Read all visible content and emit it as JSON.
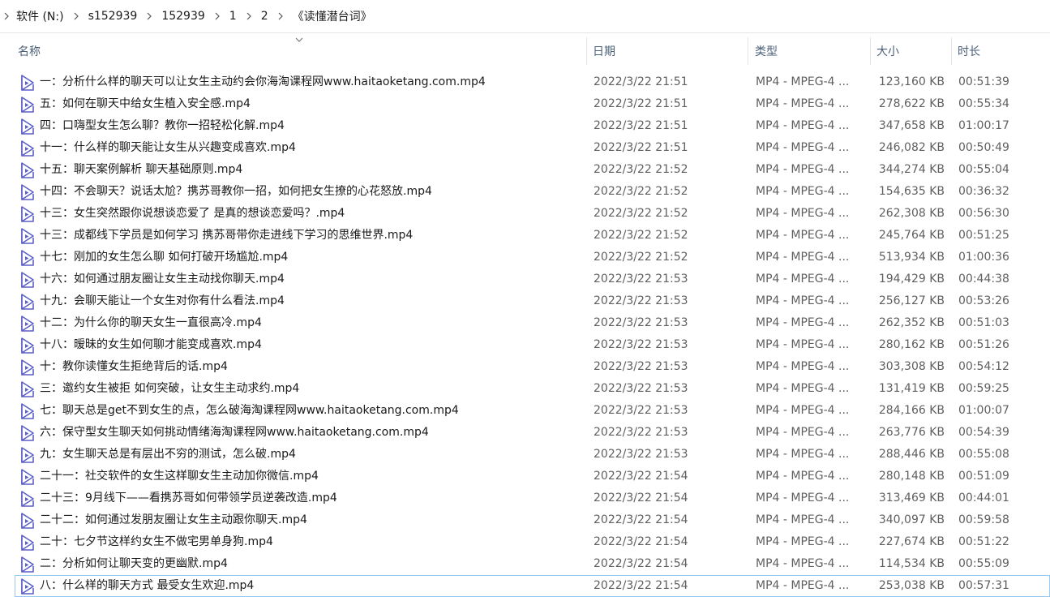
{
  "breadcrumb": [
    "软件 (N:)",
    "s152939",
    "152939",
    "1",
    "2",
    "《读懂潜台词》"
  ],
  "columns": {
    "name": "名称",
    "date": "日期",
    "type": "类型",
    "size": "大小",
    "duration": "时长"
  },
  "files": [
    {
      "name": "一：分析什么样的聊天可以让女生主动约会你海淘课程网www.haitaoketang.com.mp4",
      "date": "2022/3/22 21:51",
      "type": "MP4 - MPEG-4 ...",
      "size": "123,160 KB",
      "duration": "00:51:39"
    },
    {
      "name": "五：如何在聊天中给女生植入安全感.mp4",
      "date": "2022/3/22 21:51",
      "type": "MP4 - MPEG-4 ...",
      "size": "278,622 KB",
      "duration": "00:55:34"
    },
    {
      "name": "四：口嗨型女生怎么聊？教你一招轻松化解.mp4",
      "date": "2022/3/22 21:51",
      "type": "MP4 - MPEG-4 ...",
      "size": "347,658 KB",
      "duration": "01:00:17"
    },
    {
      "name": "十一：什么样的聊天能让女生从兴趣变成喜欢.mp4",
      "date": "2022/3/22 21:51",
      "type": "MP4 - MPEG-4 ...",
      "size": "246,082 KB",
      "duration": "00:50:49"
    },
    {
      "name": "十五：聊天案例解析 聊天基础原则.mp4",
      "date": "2022/3/22 21:52",
      "type": "MP4 - MPEG-4 ...",
      "size": "344,274 KB",
      "duration": "00:55:04"
    },
    {
      "name": "十四：不会聊天？说话太尬？携苏哥教你一招，如何把女生撩的心花怒放.mp4",
      "date": "2022/3/22 21:52",
      "type": "MP4 - MPEG-4 ...",
      "size": "154,635 KB",
      "duration": "00:36:32"
    },
    {
      "name": "十三：女生突然跟你说想谈恋爱了 是真的想谈恋爱吗？.mp4",
      "date": "2022/3/22 21:52",
      "type": "MP4 - MPEG-4 ...",
      "size": "262,308 KB",
      "duration": "00:56:30"
    },
    {
      "name": "十三：成都线下学员是如何学习 携苏哥带你走进线下学习的思维世界.mp4",
      "date": "2022/3/22 21:52",
      "type": "MP4 - MPEG-4 ...",
      "size": "245,764 KB",
      "duration": "00:51:25"
    },
    {
      "name": "十七：刚加的女生怎么聊 如何打破开场尴尬.mp4",
      "date": "2022/3/22 21:52",
      "type": "MP4 - MPEG-4 ...",
      "size": "513,934 KB",
      "duration": "01:00:36"
    },
    {
      "name": "十六：如何通过朋友圈让女生主动找你聊天.mp4",
      "date": "2022/3/22 21:53",
      "type": "MP4 - MPEG-4 ...",
      "size": "194,429 KB",
      "duration": "00:44:38"
    },
    {
      "name": "十九：会聊天能让一个女生对你有什么看法.mp4",
      "date": "2022/3/22 21:53",
      "type": "MP4 - MPEG-4 ...",
      "size": "256,127 KB",
      "duration": "00:53:26"
    },
    {
      "name": "十二：为什么你的聊天女生一直很高冷.mp4",
      "date": "2022/3/22 21:53",
      "type": "MP4 - MPEG-4 ...",
      "size": "262,352 KB",
      "duration": "00:51:03"
    },
    {
      "name": "十八：暧昧的女生如何聊才能变成喜欢.mp4",
      "date": "2022/3/22 21:53",
      "type": "MP4 - MPEG-4 ...",
      "size": "280,162 KB",
      "duration": "00:51:26"
    },
    {
      "name": "十：教你读懂女生拒绝背后的话.mp4",
      "date": "2022/3/22 21:53",
      "type": "MP4 - MPEG-4 ...",
      "size": "303,308 KB",
      "duration": "00:54:12"
    },
    {
      "name": "三：邀约女生被拒 如何突破，让女生主动求约.mp4",
      "date": "2022/3/22 21:53",
      "type": "MP4 - MPEG-4 ...",
      "size": "131,419 KB",
      "duration": "00:59:25"
    },
    {
      "name": "七：聊天总是get不到女生的点，怎么破海淘课程网www.haitaoketang.com.mp4",
      "date": "2022/3/22 21:53",
      "type": "MP4 - MPEG-4 ...",
      "size": "284,166 KB",
      "duration": "01:00:07"
    },
    {
      "name": "六：保守型女生聊天如何挑动情绪海淘课程网www.haitaoketang.com.mp4",
      "date": "2022/3/22 21:53",
      "type": "MP4 - MPEG-4 ...",
      "size": "263,776 KB",
      "duration": "00:54:39"
    },
    {
      "name": "九：女生聊天总是有层出不穷的测试，怎么破.mp4",
      "date": "2022/3/22 21:53",
      "type": "MP4 - MPEG-4 ...",
      "size": "288,446 KB",
      "duration": "00:55:08"
    },
    {
      "name": "二十一：社交软件的女生这样聊女生主动加你微信.mp4",
      "date": "2022/3/22 21:54",
      "type": "MP4 - MPEG-4 ...",
      "size": "280,148 KB",
      "duration": "00:51:09"
    },
    {
      "name": "二十三：9月线下——看携苏哥如何带领学员逆袭改造.mp4",
      "date": "2022/3/22 21:54",
      "type": "MP4 - MPEG-4 ...",
      "size": "313,469 KB",
      "duration": "00:44:01"
    },
    {
      "name": "二十二：如何通过发朋友圈让女生主动跟你聊天.mp4",
      "date": "2022/3/22 21:54",
      "type": "MP4 - MPEG-4 ...",
      "size": "340,097 KB",
      "duration": "00:59:58"
    },
    {
      "name": "二十：七夕节这样约女生不做宅男单身狗.mp4",
      "date": "2022/3/22 21:54",
      "type": "MP4 - MPEG-4 ...",
      "size": "227,674 KB",
      "duration": "00:51:22"
    },
    {
      "name": "二：分析如何让聊天变的更幽默.mp4",
      "date": "2022/3/22 21:54",
      "type": "MP4 - MPEG-4 ...",
      "size": "114,534 KB",
      "duration": "00:55:09"
    },
    {
      "name": "八：什么样的聊天方式 最受女生欢迎.mp4",
      "date": "2022/3/22 21:54",
      "type": "MP4 - MPEG-4 ...",
      "size": "253,038 KB",
      "duration": "00:57:31"
    }
  ],
  "icons": {
    "file": "video-file-icon",
    "separator": "chevron-right-icon",
    "sort": "chevron-down-icon"
  },
  "colors": {
    "header_text": "#4c607a",
    "focus_border": "#99c9ef",
    "icon_accent": "#5b5fc7"
  }
}
